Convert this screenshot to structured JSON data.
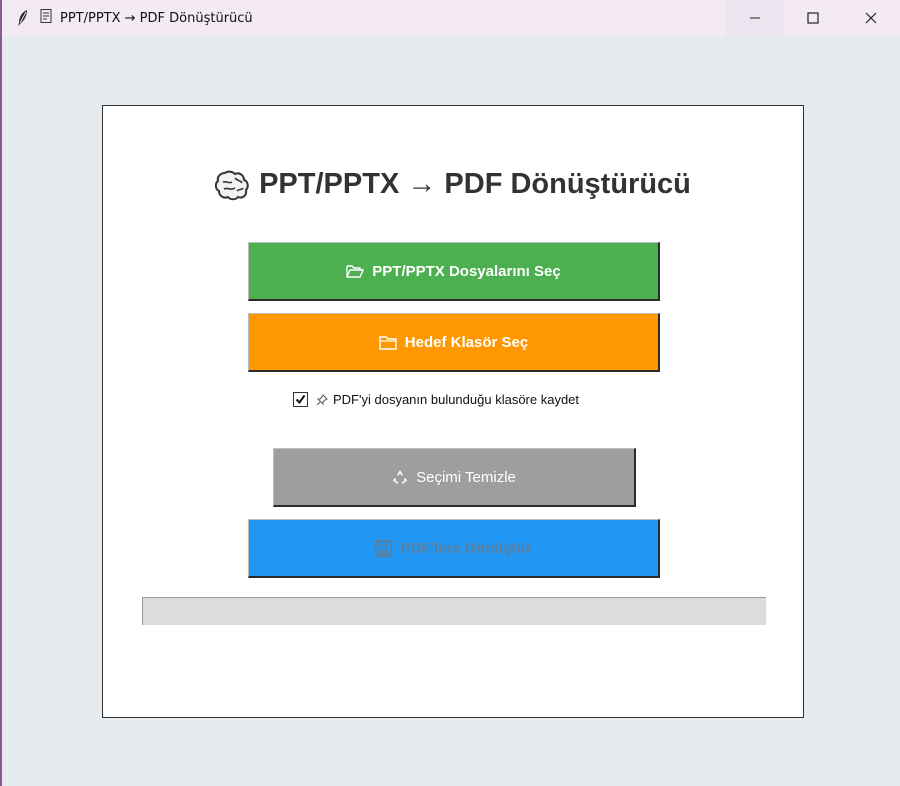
{
  "window": {
    "title": "PPT/PPTX → PDF Dönüştürücü",
    "controls": [
      "minimize",
      "maximize",
      "close"
    ]
  },
  "main": {
    "heading": "PPT/PPTX → PDF Dönüştürücü",
    "heading_icon": "brain-icon",
    "select_files_label": "PPT/PPTX Dosyalarını Seç",
    "select_files_icon": "open-folder-icon",
    "target_folder_label": "Hedef Klasör Seç",
    "target_folder_icon": "folder-icon",
    "save_same_folder_label": "PDF'yi dosyanın bulunduğu klasöre kaydet",
    "save_same_folder_checked": true,
    "save_same_folder_icon": "pushpin-icon",
    "clear_selection_label": "Seçimi Temizle",
    "clear_selection_icon": "recycle-icon",
    "convert_label": "PDF'lere Dönüştür",
    "convert_icon": "floppy-disk-icon",
    "progress": 0
  },
  "colors": {
    "select_files": "#4caf50",
    "target_folder": "#ff9800",
    "clear_selection": "#9e9e9e",
    "convert": "#2196f3",
    "progress_track": "#dcdcdc"
  }
}
